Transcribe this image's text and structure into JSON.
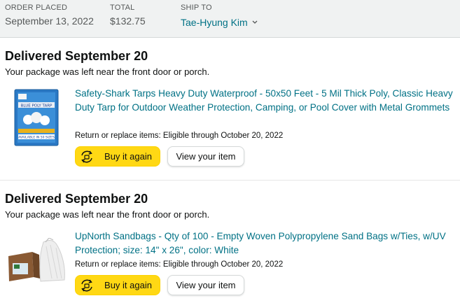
{
  "header": {
    "order_placed_label": "ORDER PLACED",
    "order_placed_value": "September 13, 2022",
    "total_label": "TOTAL",
    "total_value": "$132.75",
    "ship_to_label": "SHIP TO",
    "ship_to_value": "Tae-Hyung Kim"
  },
  "shipments": [
    {
      "status": "Delivered September 20",
      "note": "Your package was left near the front door or porch.",
      "title": "Safety-Shark Tarps Heavy Duty Waterproof - 50x50 Feet - 5 Mil Thick Poly, Classic Heavy Duty Tarp for Outdoor Weather Protection, Camping, or Pool Cover with Metal Grommets",
      "return_text": "Return or replace items: Eligible through October 20, 2022",
      "buy_again_label": "Buy it again",
      "view_item_label": "View your item",
      "thumb_text_top": "BLUE POLY TARP",
      "thumb_text_bottom": "AVAILABLE IN 50 SIZES"
    },
    {
      "status": "Delivered September 20",
      "note": "Your package was left near the front door or porch.",
      "title": "UpNorth Sandbags - Qty of 100 - Empty Woven Polypropylene Sand Bags w/Ties, w/UV Protection; size: 14\" x 26\", color: White",
      "return_text": "Return or replace items: Eligible through October 20, 2022",
      "buy_again_label": "Buy it again",
      "view_item_label": "View your item"
    }
  ],
  "colors": {
    "link": "#007185",
    "buy_button": "#ffd814",
    "header_bg": "#f0f2f2"
  }
}
